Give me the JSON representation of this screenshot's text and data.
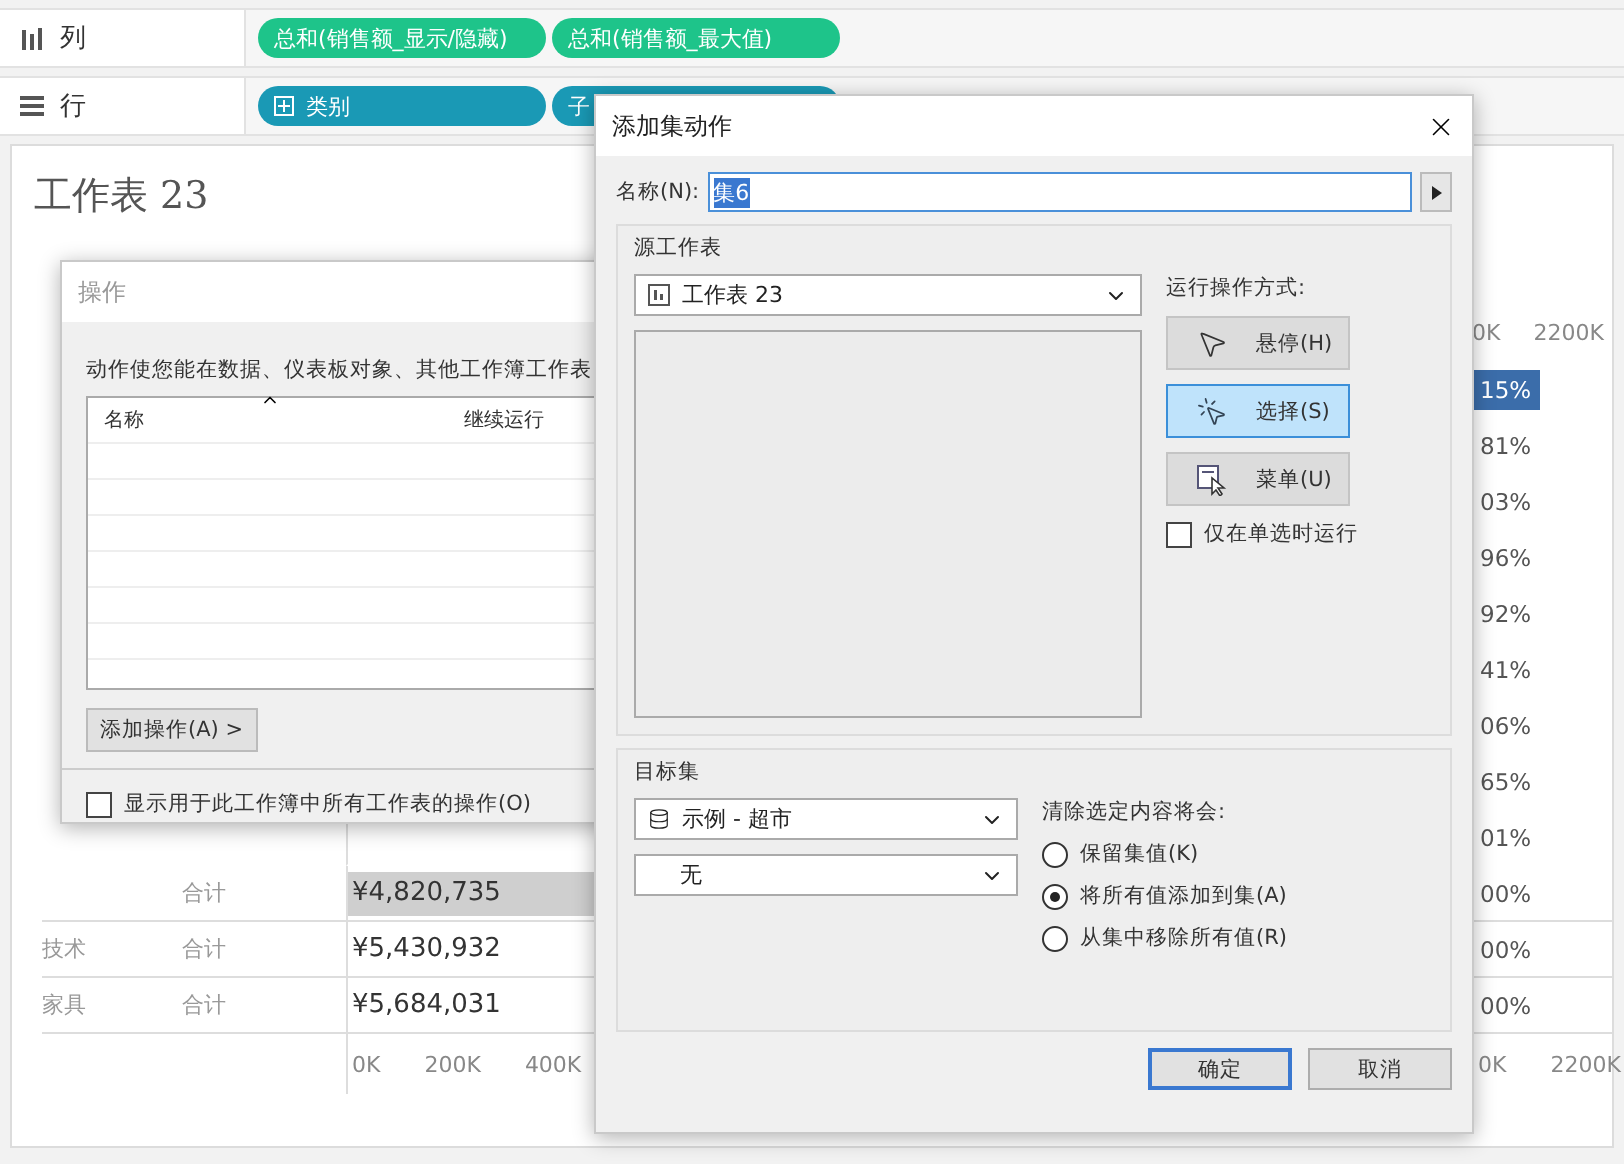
{
  "shelves": [
    {
      "kind": "columns",
      "label": "列",
      "pills": [
        {
          "text": "总和(销售额_显示/隐藏)",
          "kind": "measure",
          "expandable": false
        },
        {
          "text": "总和(销售额_最大值)",
          "kind": "measure",
          "expandable": false
        }
      ]
    },
    {
      "kind": "rows",
      "label": "行",
      "pills": [
        {
          "text": "类别",
          "kind": "dimension",
          "expandable": true
        },
        {
          "text": "子",
          "kind": "dimension",
          "expandable": false
        }
      ]
    }
  ],
  "worksheet": {
    "title": "工作表 23",
    "top_right_ticks": [
      "0K",
      "2200K"
    ],
    "rows": [
      {
        "pct": "15%",
        "selected": true
      },
      {
        "pct": "81%",
        "selected": false
      },
      {
        "pct": "03%",
        "selected": false
      },
      {
        "pct": "96%",
        "selected": false
      },
      {
        "pct": "92%",
        "selected": false
      },
      {
        "pct": "41%",
        "selected": false
      },
      {
        "pct": "06%",
        "selected": false
      },
      {
        "pct": "65%",
        "selected": false
      },
      {
        "pct": "01%",
        "selected": false
      },
      {
        "sub": "合计",
        "value": "¥4,820,735",
        "pct": "00%",
        "selected": false,
        "highlighted": true
      },
      {
        "category": "技术",
        "sub": "合计",
        "value": "¥5,430,932",
        "pct": "00%",
        "selected": false,
        "highlighted": false
      },
      {
        "category": "家具",
        "sub": "合计",
        "value": "¥5,684,031",
        "pct": "00%",
        "selected": false,
        "highlighted": false
      }
    ],
    "bottom_left_ticks": [
      "0K",
      "200K",
      "400K"
    ],
    "bottom_right_ticks": [
      "0K",
      "2200K"
    ]
  },
  "actions_dialog": {
    "title": "操作",
    "description": "动作使您能在数据、仪表板对象、其他工作簿工作表",
    "columns": [
      "名称",
      "继续运行"
    ],
    "add_button": "添加操作(A) >",
    "show_all": {
      "label": "显示用于此工作簿中所有工作表的操作(O)",
      "checked": false
    }
  },
  "set_action_dialog": {
    "title": "添加集动作",
    "name_label": "名称(N):",
    "name_value": "集6",
    "name_selected": true,
    "source": {
      "legend": "源工作表",
      "sheet": "工作表 23",
      "run_label": "运行操作方式:",
      "run_options": [
        {
          "label": "悬停(H)",
          "kind": "hover",
          "selected": false
        },
        {
          "label": "选择(S)",
          "kind": "select",
          "selected": true
        },
        {
          "label": "菜单(U)",
          "kind": "menu",
          "selected": false
        }
      ],
      "single_select": {
        "label": "仅在单选时运行",
        "checked": false
      }
    },
    "target": {
      "legend": "目标集",
      "data_source": "示例 - 超市",
      "set": "无",
      "clear_label": "清除选定内容将会:",
      "clear_options": [
        {
          "label": "保留集值(K)",
          "selected": false
        },
        {
          "label": "将所有值添加到集(A)",
          "selected": true
        },
        {
          "label": "从集中移除所有值(R)",
          "selected": false
        }
      ]
    },
    "buttons": [
      {
        "label": "确定",
        "default": true
      },
      {
        "label": "取消",
        "default": false
      }
    ]
  }
}
